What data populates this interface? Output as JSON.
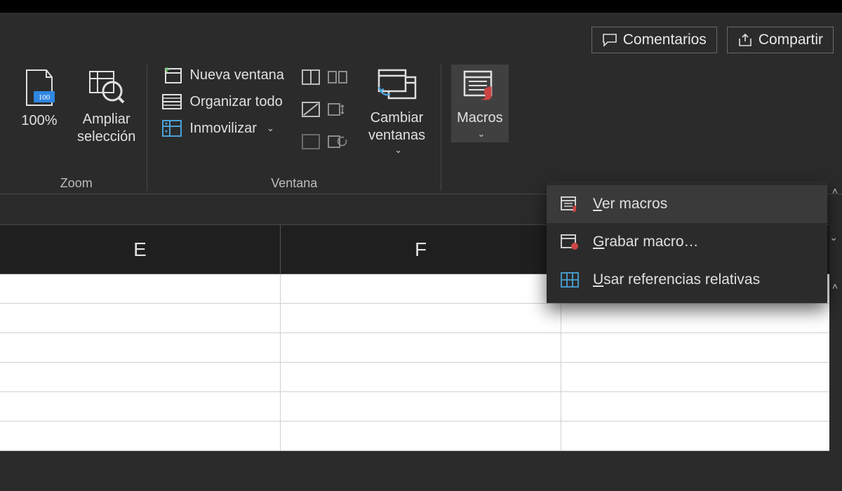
{
  "upper": {
    "comments": "Comentarios",
    "share": "Compartir"
  },
  "ribbon": {
    "zoom": {
      "group_label": "Zoom",
      "zoom100": "100%",
      "zoom_selection": "Ampliar\nselección"
    },
    "window": {
      "group_label": "Ventana",
      "new_window": "Nueva ventana",
      "arrange_all": "Organizar todo",
      "freeze": "Inmovilizar",
      "switch_windows": "Cambiar\nventanas"
    },
    "macros": {
      "label": "Macros"
    }
  },
  "menu": {
    "view_macros": "Ver macros",
    "record_macro": "Grabar macro…",
    "use_relative": "Usar referencias relativas"
  },
  "columns": [
    "E",
    "F",
    ""
  ]
}
